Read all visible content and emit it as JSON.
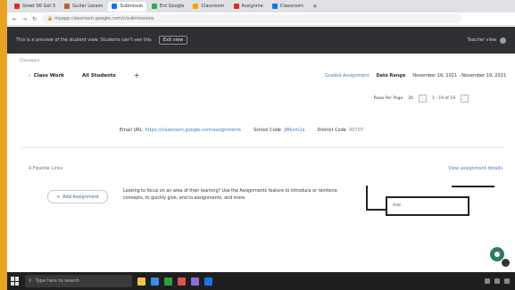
{
  "browser": {
    "tabs": [
      {
        "label": "Greet 06 Get S",
        "favicon_color": "#d93025"
      },
      {
        "label": "Guitar Lesson",
        "favicon_color": "#b0603a"
      },
      {
        "label": "Submissio",
        "favicon_color": "#1a73e8"
      },
      {
        "label": "Ent Google",
        "favicon_color": "#34a853"
      },
      {
        "label": "Classroom",
        "favicon_color": "#f2a600"
      },
      {
        "label": "Assignme",
        "favicon_color": "#d93025"
      },
      {
        "label": "Classroom",
        "favicon_color": "#1a73e8"
      }
    ],
    "new_tab_label": "+",
    "url": "myapp.classroom.google.com/c/submissions"
  },
  "banner": {
    "text": "This is a preview of the student view. Students can't see this",
    "button_label": "Exit view",
    "right_text": "Teacher view"
  },
  "nav": {
    "crumb": "Classwork",
    "back_label": "Class Work",
    "class_label": "All Students",
    "add_label": "+",
    "right_link": "Graded Assignment",
    "right_date_label": "Date Range",
    "right_date_value": "November 16, 2021 - November 19, 2021"
  },
  "pager": {
    "rows_label": "Rows Per Page",
    "rows_value": "20",
    "range_label": "1 - 19 of 19"
  },
  "summary": {
    "email_label": "Email URL",
    "email_value": "https://classroom.google.com/assignments",
    "code_label": "School Code",
    "code_value": "j8fkxm2a",
    "district_label": "District Code",
    "district_value": "00707"
  },
  "section": {
    "title": "4 Flexible Links",
    "link": "View assignment details",
    "add_button_label": "Add Assignment",
    "description": "Looking to focus on an area of their learning? Use the Assignments feature to introduce or reinforce concepts, to quickly give, and to assignments, and more."
  },
  "mini_panel": {
    "text": "Add"
  },
  "taskbar": {
    "search_placeholder": "Type here to search",
    "app_colors": [
      "#f2c14e",
      "#3c8dde",
      "#2ea043",
      "#d9534f",
      "#8e6fd8",
      "#1a73e8"
    ]
  },
  "colors": {
    "accent": "#4a78c2",
    "banner": "#2f3033",
    "chat": "#2e7d5b",
    "frame": "#e8a326"
  }
}
